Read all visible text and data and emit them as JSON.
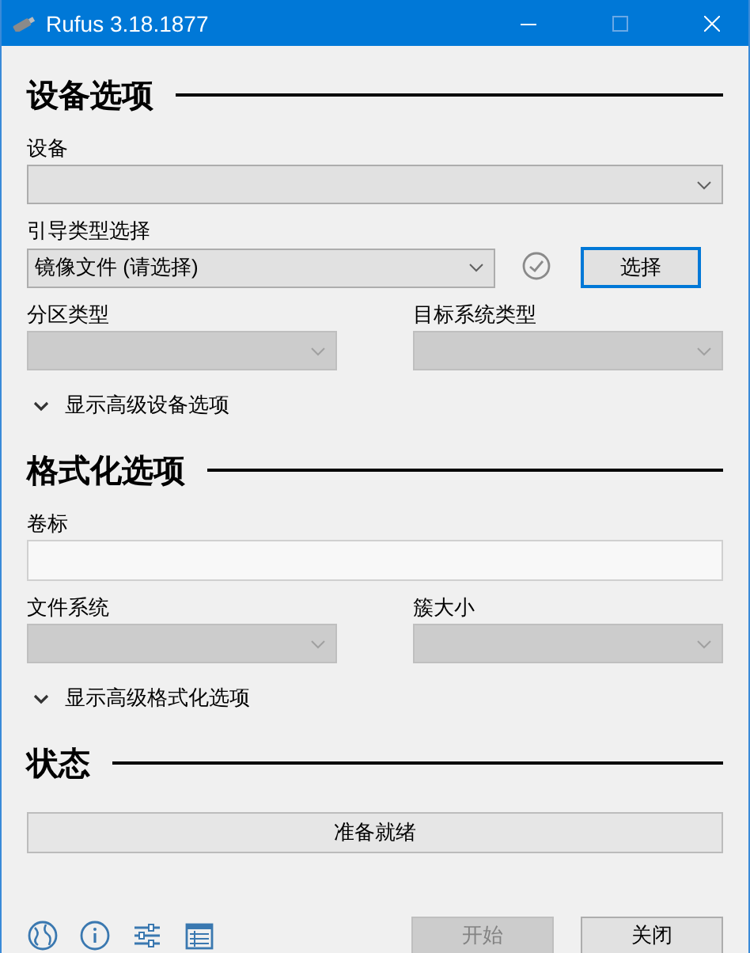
{
  "window": {
    "title": "Rufus 3.18.1877"
  },
  "sections": [
    {
      "heading": "设备选项",
      "rows": [
        {
          "kind": "dropdown",
          "label": "设备",
          "disabled": false
        },
        {
          "kind": "dropdown-button",
          "label": "引导类型选择",
          "value": "镜像文件 (请选择)",
          "disabled": false,
          "button": "选择"
        },
        {
          "kind": "pair",
          "fields": [
            {
              "label": "分区类型",
              "disabled": true
            },
            {
              "label": "目标系统类型",
              "disabled": true
            }
          ]
        }
      ],
      "toggle": {
        "label": "显示高级设备选项",
        "expanded": false
      }
    },
    {
      "heading": "格式化选项",
      "rows": [
        {
          "kind": "text",
          "label": "卷标",
          "disabled": true
        },
        {
          "kind": "pair",
          "fields": [
            {
              "label": "文件系统",
              "disabled": true
            },
            {
              "label": "簇大小",
              "disabled": true
            }
          ]
        }
      ],
      "toggle": {
        "label": "显示高级格式化选项",
        "expanded": false
      }
    },
    {
      "heading": "状态",
      "rows": [
        {
          "kind": "status",
          "value": "准备就绪"
        }
      ]
    }
  ],
  "footer": {
    "buttons": [
      {
        "label": "开始",
        "disabled": true
      },
      {
        "label": "关闭",
        "disabled": false
      }
    ]
  }
}
